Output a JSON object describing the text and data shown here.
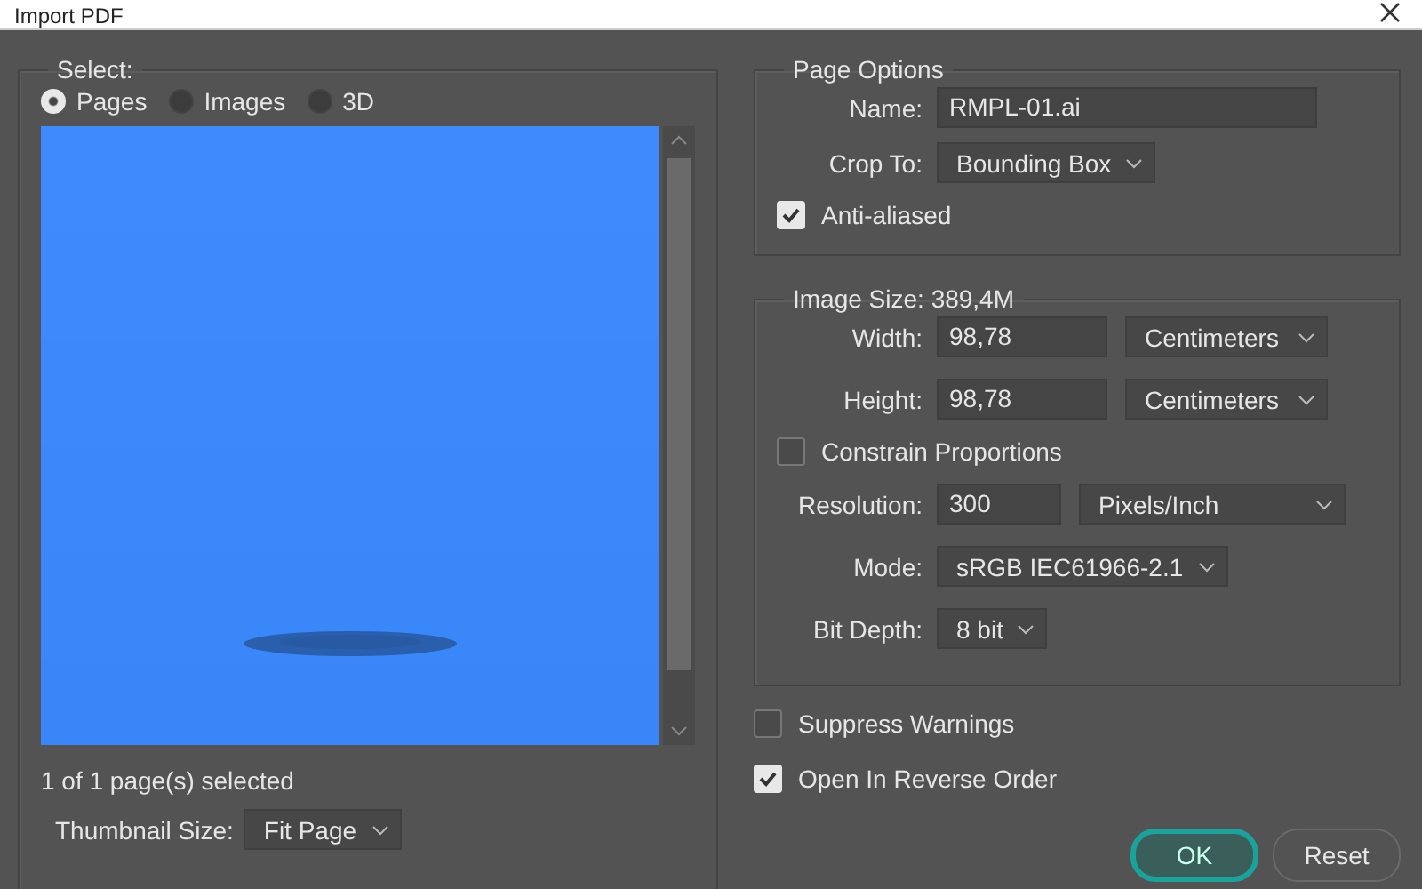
{
  "window": {
    "title": "Import PDF"
  },
  "select": {
    "title": "Select:",
    "options": [
      {
        "label": "Pages",
        "selected": true
      },
      {
        "label": "Images",
        "selected": false
      },
      {
        "label": "3D",
        "selected": false
      }
    ],
    "status": "1 of 1 page(s) selected",
    "thumbnail_size": {
      "label": "Thumbnail Size:",
      "value": "Fit Page"
    }
  },
  "page_options": {
    "title": "Page Options",
    "name": {
      "label": "Name:",
      "value": "RMPL-01.ai"
    },
    "crop_to": {
      "label": "Crop To:",
      "value": "Bounding Box"
    },
    "anti_aliased": {
      "label": "Anti-aliased",
      "checked": true
    }
  },
  "image_size": {
    "title": "Image Size: 389,4M",
    "width": {
      "label": "Width:",
      "value": "98,78",
      "unit": "Centimeters"
    },
    "height": {
      "label": "Height:",
      "value": "98,78",
      "unit": "Centimeters"
    },
    "constrain": {
      "label": "Constrain Proportions",
      "checked": false
    },
    "resolution": {
      "label": "Resolution:",
      "value": "300",
      "unit": "Pixels/Inch"
    },
    "mode": {
      "label": "Mode:",
      "value": "sRGB IEC61966-2.1"
    },
    "bit_depth": {
      "label": "Bit Depth:",
      "value": "8 bit"
    }
  },
  "options": [
    {
      "label": "Suppress Warnings",
      "checked": false
    },
    {
      "label": "Open In Reverse Order",
      "checked": true
    }
  ],
  "buttons": [
    {
      "label": "OK",
      "default": true
    },
    {
      "label": "Reset",
      "default": false
    }
  ]
}
